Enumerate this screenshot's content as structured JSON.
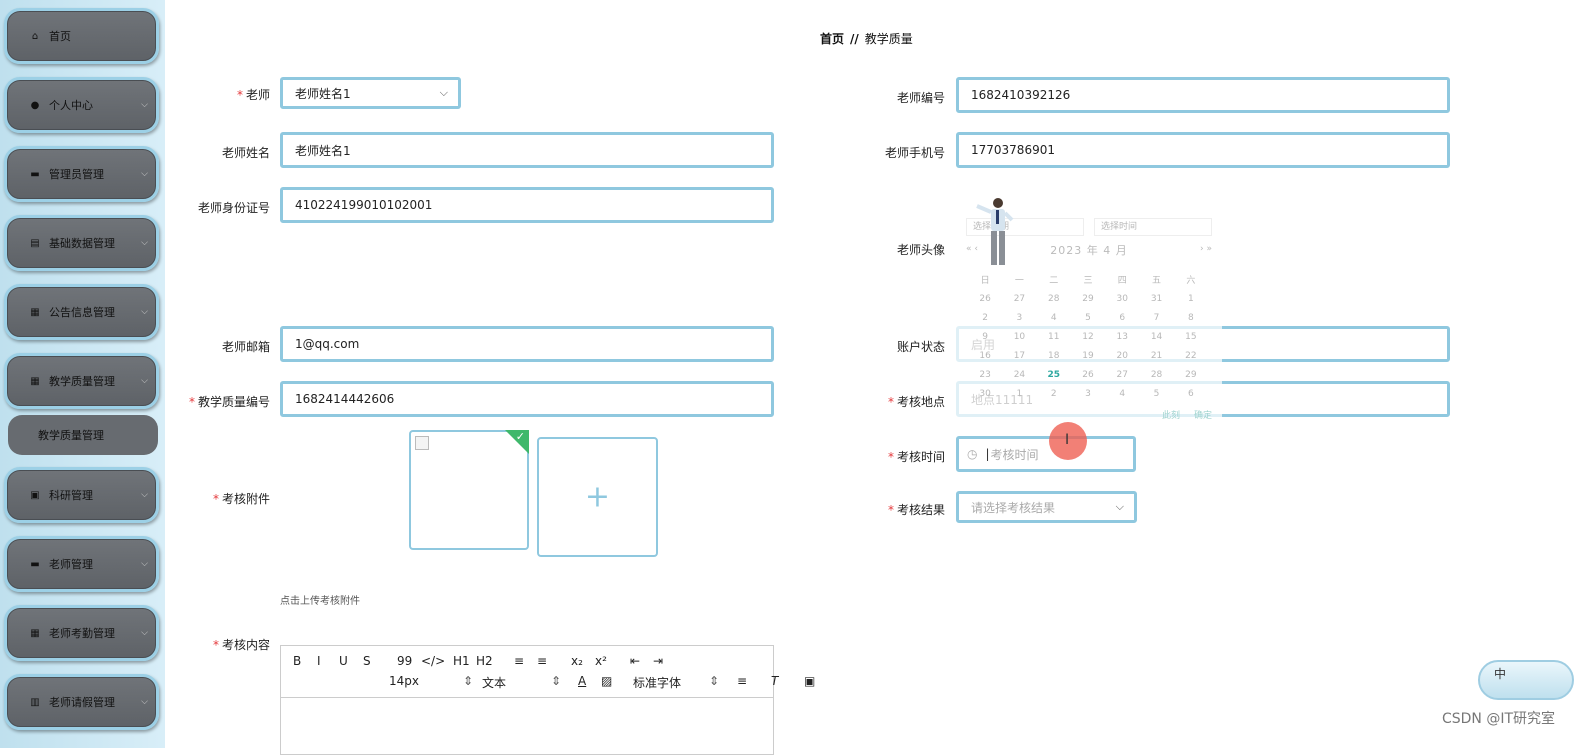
{
  "sidebar": {
    "items": [
      {
        "label": "首页",
        "icon": "home-icon",
        "glyph": "⌂"
      },
      {
        "label": "个人中心",
        "icon": "user-icon",
        "glyph": "●"
      },
      {
        "label": "管理员管理",
        "icon": "briefcase-icon",
        "glyph": "▬"
      },
      {
        "label": "基础数据管理",
        "icon": "clipboard-icon",
        "glyph": "▤"
      },
      {
        "label": "公告信息管理",
        "icon": "grid-icon",
        "glyph": "▦"
      },
      {
        "label": "教学质量管理",
        "icon": "grid-icon",
        "glyph": "▦"
      },
      {
        "label": "科研管理",
        "icon": "document-icon",
        "glyph": "▣"
      },
      {
        "label": "老师管理",
        "icon": "teacher-icon",
        "glyph": "▬"
      },
      {
        "label": "老师考勤管理",
        "icon": "grid-icon",
        "glyph": "▦"
      },
      {
        "label": "老师请假管理",
        "icon": "bar-chart-icon",
        "glyph": "▥"
      }
    ],
    "sub_item": "教学质量管理"
  },
  "breadcrumb": {
    "home": "首页",
    "separator": "//",
    "current": "教学质量"
  },
  "form": {
    "teacher_label": "老师",
    "teacher_value": "老师姓名1",
    "teacher_name_label": "老师姓名",
    "teacher_name_value": "老师姓名1",
    "teacher_id_card_label": "老师身份证号",
    "teacher_id_card_value": "410224199010102001",
    "teacher_email_label": "老师邮箱",
    "teacher_email_value": "1@qq.com",
    "quality_no_label": "教学质量编号",
    "quality_no_value": "1682414442606",
    "attachment_label": "考核附件",
    "attachment_hint": "点击上传考核附件",
    "content_label": "考核内容",
    "teacher_no_label": "老师编号",
    "teacher_no_value": "1682410392126",
    "teacher_phone_label": "老师手机号",
    "teacher_phone_value": "17703786901",
    "avatar_label": "老师头像",
    "account_status_label": "账户状态",
    "account_status_value": "启用",
    "location_label": "考核地点",
    "location_value": "地点11111",
    "exam_time_label": "考核时间",
    "exam_time_placeholder": "考核时间",
    "result_label": "考核结果",
    "result_placeholder": "请选择考核结果"
  },
  "editor": {
    "row1": [
      "B",
      "I",
      "U",
      "S",
      "99",
      "</>",
      "H1",
      "H2",
      "≡",
      "≡",
      "x₂",
      "x²",
      "⇤",
      "⇥"
    ],
    "font_size": "14px",
    "text_style": "文本",
    "font_family": "标准字体"
  },
  "calendar": {
    "date_placeholder": "选择日期",
    "time_placeholder": "选择时间",
    "header": "2023 年 4 月",
    "nav_prev": "« ‹",
    "nav_next": "› »",
    "weekdays": [
      "日",
      "一",
      "二",
      "三",
      "四",
      "五",
      "六"
    ],
    "weeks": [
      [
        "26",
        "27",
        "28",
        "29",
        "30",
        "31",
        "1"
      ],
      [
        "2",
        "3",
        "4",
        "5",
        "6",
        "7",
        "8"
      ],
      [
        "9",
        "10",
        "11",
        "12",
        "13",
        "14",
        "15"
      ],
      [
        "16",
        "17",
        "18",
        "19",
        "20",
        "21",
        "22"
      ],
      [
        "23",
        "24",
        "25",
        "26",
        "27",
        "28",
        "29"
      ],
      [
        "30",
        "1",
        "2",
        "3",
        "4",
        "5",
        "6"
      ]
    ],
    "today": "25",
    "now_label": "此刻",
    "confirm_label": "确定"
  },
  "ime": {
    "label": "中"
  },
  "watermark": "CSDN @IT研究室",
  "colors": {
    "field_border": "#8fc8df",
    "sidebar_bg": "#bfe0ee",
    "required": "#e4393c",
    "upload_ok": "#3fb86b"
  }
}
